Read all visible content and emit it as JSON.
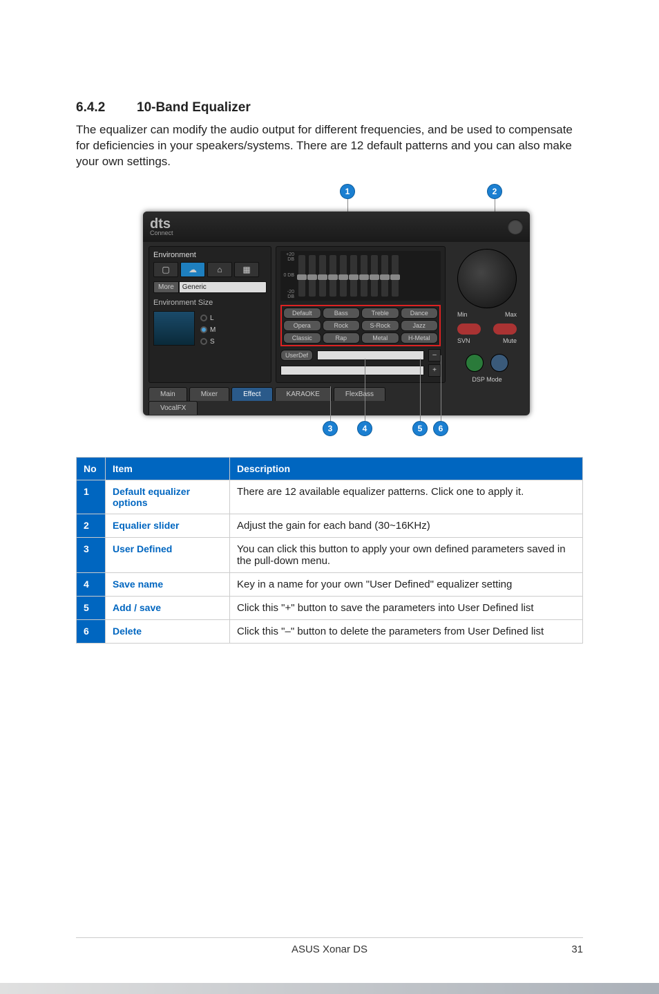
{
  "heading": {
    "number": "6.4.2",
    "title": "10-Band Equalizer"
  },
  "intro": "The equalizer can modify the audio output for different frequencies, and be used to compensate for deficiencies in your speakers/systems. There are 12 default patterns and you can also make your own settings.",
  "markers": {
    "m1": "1",
    "m2": "2",
    "m3": "3",
    "m4": "4",
    "m5": "5",
    "m6": "6"
  },
  "app": {
    "logo": "dts",
    "logo_sub": "Connect",
    "env_label": "Environment",
    "more_btn": "More",
    "more_value": "Generic",
    "size_label": "Environment Size",
    "size_opts": {
      "l": "L",
      "m": "M",
      "s": "S"
    },
    "eq_labels": {
      "top": "+20 DB",
      "mid": "0 DB",
      "bot": "-20 DB"
    },
    "presets": [
      "Default",
      "Bass",
      "Treble",
      "Dance",
      "Opera",
      "Rock",
      "S-Rock",
      "Jazz",
      "Classic",
      "Rap",
      "Metal",
      "H-Metal"
    ],
    "userdef": "UserDef",
    "vol": {
      "min": "Min",
      "max": "Max"
    },
    "toggles": {
      "svn": "SVN",
      "mute": "Mute"
    },
    "dsp_label": "DSP Mode",
    "tabs": [
      "Main",
      "Mixer",
      "Effect",
      "KARAOKE",
      "FlexBass"
    ],
    "tabs2": [
      "VocalFX"
    ]
  },
  "table": {
    "headers": {
      "no": "No",
      "item": "Item",
      "desc": "Description"
    },
    "rows": [
      {
        "no": "1",
        "item": "Default equalizer options",
        "desc": "There are 12 available equalizer patterns. Click one to apply it."
      },
      {
        "no": "2",
        "item": "Equalier slider",
        "desc": "Adjust the gain for each band (30~16KHz)"
      },
      {
        "no": "3",
        "item": "User Defined",
        "desc": "You can click this button to apply your own defined parameters saved in the pull-down menu."
      },
      {
        "no": "4",
        "item": "Save name",
        "desc": "Key in a name for your own \"User Defined\" equalizer setting"
      },
      {
        "no": "5",
        "item": "Add / save",
        "desc": "Click this \"+\" button to save the parameters into User Defined list"
      },
      {
        "no": "6",
        "item": "Delete",
        "desc": "Click this \"–\" button to delete the parameters from User Defined list"
      }
    ]
  },
  "footer": {
    "product": "ASUS Xonar DS",
    "page": "31"
  }
}
